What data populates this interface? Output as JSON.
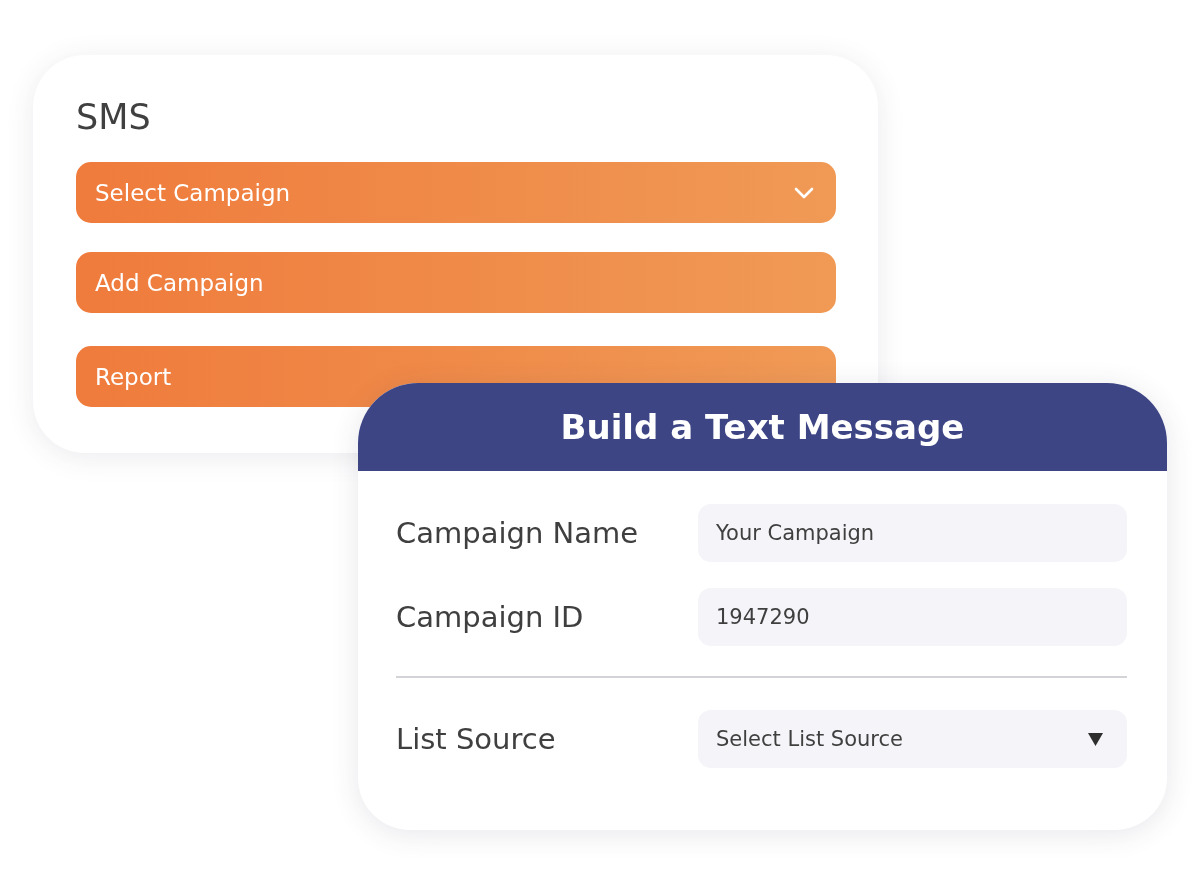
{
  "sms_card": {
    "title": "SMS",
    "items": [
      {
        "kind": "dropdown",
        "label": "Select Campaign"
      },
      {
        "kind": "button",
        "label": "Add Campaign"
      },
      {
        "kind": "button",
        "label": "Report"
      }
    ]
  },
  "message_card": {
    "title": "Build a Text Message",
    "sections": [
      {
        "fields": [
          {
            "kind": "text",
            "label": "Campaign Name",
            "value": "Your Campaign"
          },
          {
            "kind": "text",
            "label": "Campaign ID",
            "value": "1947290"
          }
        ]
      },
      {
        "fields": [
          {
            "kind": "select",
            "label": "List Source",
            "value": "Select List Source"
          }
        ]
      }
    ]
  }
}
